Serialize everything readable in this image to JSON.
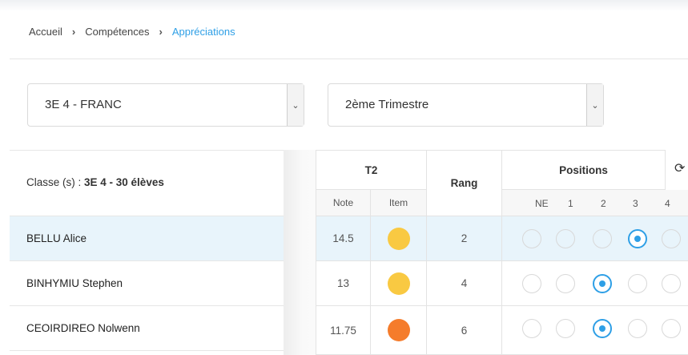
{
  "breadcrumb": {
    "home": "Accueil",
    "competences": "Compétences",
    "current": "Appréciations",
    "separator": "›"
  },
  "filters": {
    "class_value": "3E 4 - FRANC",
    "period_value": "2ème Trimestre",
    "caret": "⌄"
  },
  "class_info": {
    "label": "Classe (s) : ",
    "value": "3E 4 - 30 élèves"
  },
  "table": {
    "group_t2": "T2",
    "col_note": "Note",
    "col_item": "Item",
    "col_rang": "Rang",
    "group_positions": "Positions",
    "positions": [
      "NE",
      "1",
      "2",
      "3",
      "4"
    ],
    "refresh_icon": "⟳"
  },
  "students": [
    {
      "name": "BELLU Alice",
      "note": "14.5",
      "item_color": "#f9c942",
      "rang": "2",
      "position": "3"
    },
    {
      "name": "BINHYMIU Stephen",
      "note": "13",
      "item_color": "#f9c942",
      "rang": "4",
      "position": "2"
    },
    {
      "name": "CEOIRDIREO Nolwenn",
      "note": "11.75",
      "item_color": "#f57c2b",
      "rang": "6",
      "position": "2"
    }
  ],
  "colors": {
    "accent": "#2e9fe6",
    "selected_row": "#e8f4fb"
  }
}
